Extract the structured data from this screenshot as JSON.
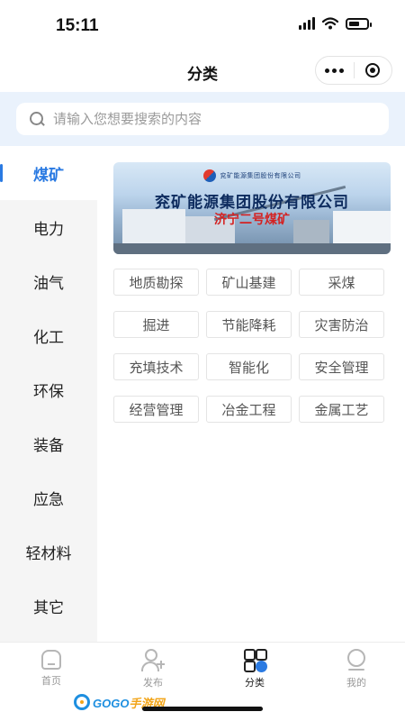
{
  "status_bar": {
    "time": "15:11",
    "battery_level": 0.6
  },
  "nav": {
    "title": "分类"
  },
  "search": {
    "placeholder": "请输入您想要搜索的内容"
  },
  "sidebar": {
    "active_index": 0,
    "items": [
      {
        "label": "煤矿"
      },
      {
        "label": "电力"
      },
      {
        "label": "油气"
      },
      {
        "label": "化工"
      },
      {
        "label": "环保"
      },
      {
        "label": "装备"
      },
      {
        "label": "应急"
      },
      {
        "label": "轻材料"
      },
      {
        "label": "其它"
      }
    ]
  },
  "banner": {
    "logo_text": "兖矿能源集团股份有限公司",
    "company": "兖矿能源集团股份有限公司",
    "mine": "济宁二号煤矿"
  },
  "tags": [
    [
      "地质勘探",
      "矿山基建",
      "采煤"
    ],
    [
      "掘进",
      "节能降耗",
      "灾害防治"
    ],
    [
      "充填技术",
      "智能化",
      "安全管理"
    ],
    [
      "经营管理",
      "冶金工程",
      "金属工艺"
    ]
  ],
  "tab_bar": {
    "active": "category",
    "items": [
      {
        "id": "home",
        "label": "首页",
        "icon": "home-icon"
      },
      {
        "id": "publish",
        "label": "发布",
        "icon": "add-user-icon"
      },
      {
        "id": "category",
        "label": "分类",
        "icon": "category-grid-icon"
      },
      {
        "id": "mine",
        "label": "我的",
        "icon": "profile-icon"
      }
    ]
  },
  "watermark": {
    "brand_a": "GOGO",
    "brand_b": "手游网"
  },
  "colors": {
    "accent": "#2a7ae2",
    "search_band": "#eaf2fc",
    "sidebar_bg": "#f5f5f5"
  }
}
